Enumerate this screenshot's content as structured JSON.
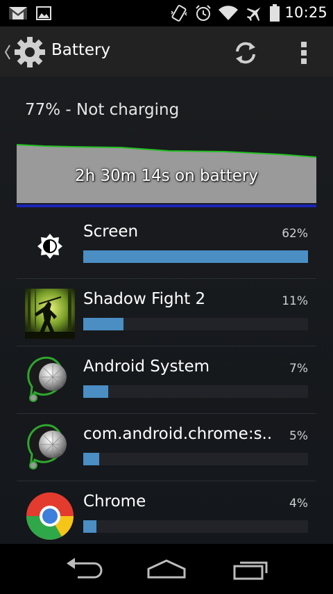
{
  "status_bar": {
    "time": "10:25",
    "icons": [
      "gmail-icon",
      "gallery-icon",
      "vibrate-icon",
      "alarm-icon",
      "wifi-icon",
      "airplane-icon",
      "battery-icon"
    ]
  },
  "action_bar": {
    "title": "Battery",
    "icons": [
      "back-caret-icon",
      "settings-gear-icon",
      "refresh-icon",
      "overflow-menu-icon"
    ]
  },
  "battery": {
    "status": "77% - Not charging",
    "graph_label": "2h 30m 14s on battery",
    "graph_line_color": "#22c022",
    "graph_fill_color": "#9a9a9a",
    "graph_bar_color": "#1a24b8"
  },
  "usage": [
    {
      "name": "Screen",
      "percent_label": "62%",
      "fraction": 1.0,
      "icon": "brightness-icon"
    },
    {
      "name": "Shadow Fight 2",
      "percent_label": "11%",
      "fraction": 0.18,
      "icon": "shadow-fight-app-icon"
    },
    {
      "name": "Android System",
      "percent_label": "7%",
      "fraction": 0.11,
      "icon": "android-system-icon"
    },
    {
      "name": "com.android.chrome:s..",
      "percent_label": "5%",
      "fraction": 0.07,
      "icon": "android-system-icon"
    },
    {
      "name": "Chrome",
      "percent_label": "4%",
      "fraction": 0.06,
      "icon": "chrome-icon"
    }
  ],
  "nav_bar": {
    "buttons": [
      "back-icon",
      "home-icon",
      "recents-icon"
    ]
  },
  "accent_color": "#4a8ec4"
}
